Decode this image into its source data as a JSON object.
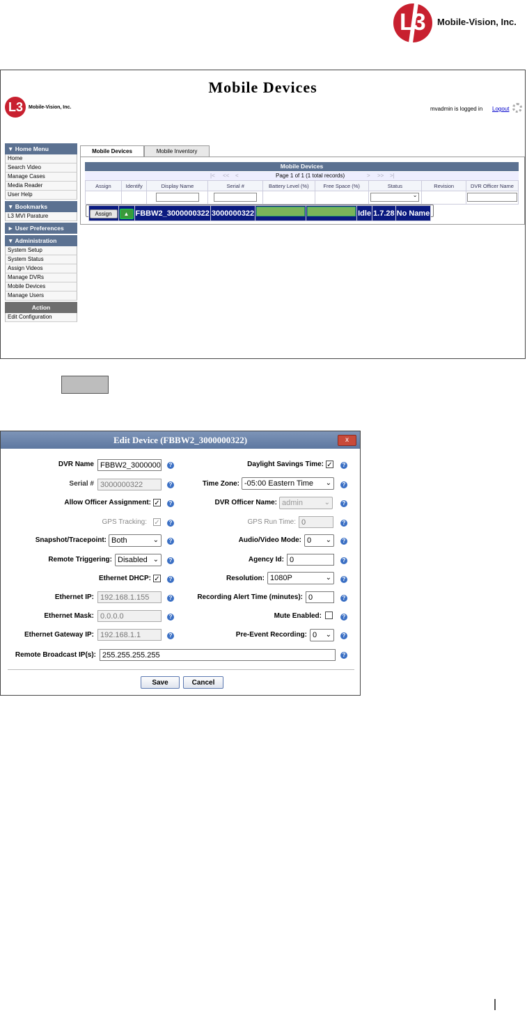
{
  "brand": {
    "name": "Mobile-Vision, Inc.",
    "logo_text": "L3"
  },
  "screen1": {
    "title": "Mobile Devices",
    "mini_brand": "Mobile-Vision, Inc.",
    "logged_in_text": "mvadmin is logged in",
    "logout": "Logout",
    "menu": {
      "home_menu": "▼ Home Menu",
      "home_items": [
        "Home",
        "Search Video",
        "Manage Cases",
        "Media Reader",
        "User Help"
      ],
      "bookmarks": "▼ Bookmarks",
      "bookmark_items": [
        "L3 MVI Parature"
      ],
      "user_prefs": "► User Preferences",
      "administration": "▼ Administration",
      "admin_items": [
        "System Setup",
        "System Status",
        "Assign Videos",
        "Manage DVRs",
        "Mobile Devices",
        "Manage Users"
      ],
      "action": "Action",
      "action_items": [
        "Edit Configuration"
      ]
    },
    "tabs": [
      "Mobile Devices",
      "Mobile Inventory"
    ],
    "grid": {
      "title": "Mobile Devices",
      "pager_text": "Page 1 of 1 (1 total records)",
      "columns": [
        "Assign",
        "Identify",
        "Display Name",
        "Serial #",
        "Battery Level (%)",
        "Free Space (%)",
        "Status",
        "Revision",
        "DVR Officer Name"
      ],
      "row": {
        "assign": "Assign",
        "display_name": "FBBW2_3000000322",
        "serial": "3000000322",
        "battery_level": 1.0,
        "free_space": 1.0,
        "status": "Idle",
        "revision": "1.7.28",
        "officer": "No Name"
      }
    }
  },
  "dialog": {
    "title": "Edit Device (FBBW2_3000000322)",
    "close": "x",
    "labels": {
      "dvr_name": "DVR Name",
      "serial": "Serial #",
      "allow_officer": "Allow Officer Assignment:",
      "gps_tracking": "GPS Tracking:",
      "snapshot": "Snapshot/Tracepoint:",
      "remote_triggering": "Remote Triggering:",
      "ethernet_dhcp": "Ethernet DHCP:",
      "ethernet_ip": "Ethernet IP:",
      "ethernet_mask": "Ethernet Mask:",
      "ethernet_gateway": "Ethernet Gateway IP:",
      "remote_broadcast": "Remote Broadcast IP(s):",
      "daylight": "Daylight Savings Time:",
      "time_zone": "Time Zone:",
      "dvr_officer": "DVR Officer Name:",
      "gps_run_time": "GPS Run Time:",
      "av_mode": "Audio/Video Mode:",
      "agency_id": "Agency Id:",
      "resolution": "Resolution:",
      "rec_alert": "Recording Alert Time (minutes):",
      "mute": "Mute Enabled:",
      "pre_event": "Pre-Event Recording:"
    },
    "values": {
      "dvr_name": "FBBW2_3000000322",
      "serial": "3000000322",
      "snapshot": "Both",
      "remote_triggering": "Disabled",
      "ethernet_ip": "192.168.1.155",
      "ethernet_mask": "0.0.0.0",
      "ethernet_gateway": "192.168.1.1",
      "remote_broadcast": "255.255.255.255",
      "time_zone": "-05:00 Eastern Time",
      "dvr_officer": "admin",
      "gps_run_time": "0",
      "av_mode": "0",
      "agency_id": "0",
      "resolution": "1080P",
      "rec_alert": "0",
      "pre_event": "0"
    },
    "checks": {
      "checked": "✓"
    },
    "help_glyph": "?",
    "buttons": {
      "save": "Save",
      "cancel": "Cancel"
    }
  }
}
